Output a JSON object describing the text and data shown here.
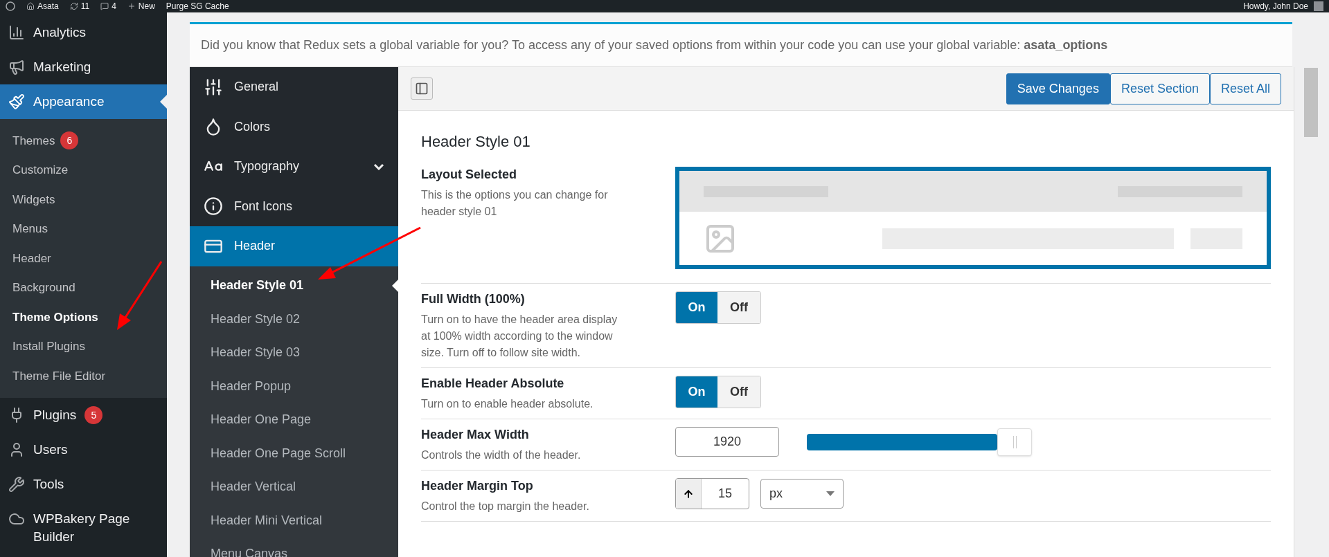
{
  "admin_bar": {
    "items": [
      {
        "kind": "site",
        "label": "Asata"
      },
      {
        "kind": "updates",
        "label": "11"
      },
      {
        "kind": "comments",
        "label": "4"
      },
      {
        "kind": "new",
        "label": "New"
      },
      {
        "kind": "plain",
        "label": "Purge SG Cache"
      }
    ],
    "greeting": "Howdy, John Doe"
  },
  "wp_menu": [
    {
      "label": "Analytics",
      "selected": false
    },
    {
      "label": "Marketing",
      "selected": false
    },
    {
      "label": "Appearance",
      "selected": true,
      "children": [
        {
          "label": "Themes",
          "badge": "6",
          "selected": false
        },
        {
          "label": "Customize",
          "selected": false
        },
        {
          "label": "Widgets",
          "selected": false
        },
        {
          "label": "Menus",
          "selected": false
        },
        {
          "label": "Header",
          "selected": false
        },
        {
          "label": "Background",
          "selected": false
        },
        {
          "label": "Theme Options",
          "selected": true
        },
        {
          "label": "Install Plugins",
          "selected": false
        },
        {
          "label": "Theme File Editor",
          "selected": false
        }
      ]
    },
    {
      "label": "Plugins",
      "badge": "5",
      "selected": false
    },
    {
      "label": "Users",
      "selected": false
    },
    {
      "label": "Tools",
      "selected": false
    },
    {
      "label": "WPBakery Page Builder",
      "selected": false
    }
  ],
  "notice": {
    "text": "Did you know that Redux sets a global variable for you? To access any of your saved options from within your code you can use your global variable: **asata_options**"
  },
  "redux_menu": [
    {
      "label": "General",
      "selected": false
    },
    {
      "label": "Colors",
      "selected": false
    },
    {
      "label": "Typography",
      "selected": false,
      "expanded": false
    },
    {
      "label": "Font Icons",
      "selected": false
    },
    {
      "label": "Header",
      "selected": true,
      "children": [
        {
          "label": "Header Style 01",
          "selected": true
        },
        {
          "label": "Header Style 02",
          "selected": false
        },
        {
          "label": "Header Style 03",
          "selected": false
        },
        {
          "label": "Header Popup",
          "selected": false
        },
        {
          "label": "Header One Page",
          "selected": false
        },
        {
          "label": "Header One Page Scroll",
          "selected": false
        },
        {
          "label": "Header Vertical",
          "selected": false
        },
        {
          "label": "Header Mini Vertical",
          "selected": false
        },
        {
          "label": "Menu Canvas",
          "selected": false
        }
      ]
    }
  ],
  "toolbar": {
    "buttons": [
      {
        "label": "Save Changes",
        "primary": true
      },
      {
        "label": "Reset Section",
        "primary": false
      },
      {
        "label": "Reset All",
        "primary": false
      }
    ]
  },
  "section_title": "Header Style 01",
  "fields": [
    {
      "kind": "layout",
      "title": "Layout Selected",
      "description": "This is the options you can change for header style 01"
    },
    {
      "kind": "switch",
      "title": "Full Width (100%)",
      "description": "Turn on to have the header area display at 100% width according to the window size. Turn off to follow site width.",
      "on_label": "On",
      "off_label": "Off",
      "on": true
    },
    {
      "kind": "switch",
      "title": "Enable Header Absolute",
      "description": "Turn on to enable header absolute.",
      "on_label": "On",
      "off_label": "Off",
      "on": true
    },
    {
      "kind": "slider",
      "title": "Header Max Width",
      "description": "Controls the width of the header.",
      "value": "1920",
      "level": 1
    },
    {
      "kind": "spinner",
      "title": "Header Margin Top",
      "description": "Control the top margin the header.",
      "value": "15",
      "unit": "px"
    }
  ]
}
